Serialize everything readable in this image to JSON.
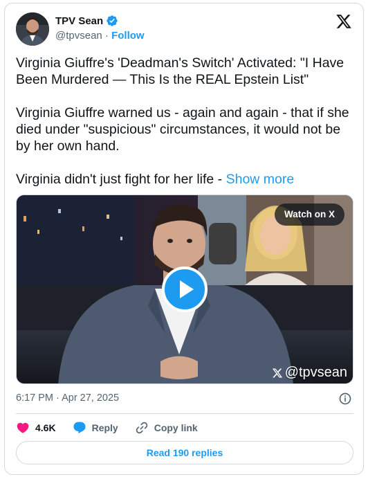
{
  "author": {
    "name": "TPV Sean",
    "handle": "@tpvsean",
    "separator": " · ",
    "follow_label": "Follow",
    "verified": true
  },
  "tweet": {
    "paragraphs": [
      "Virginia Giuffre's 'Deadman's Switch' Activated: \"I Have Been Murdered — This Is the REAL Epstein List\"",
      "Virginia Giuffre warned us - again and again - that if she died under \"suspicious\" circumstances, it would not be by her own hand.",
      "Virginia didn't just fight for her life - "
    ],
    "show_more_label": "Show more",
    "timestamp": "6:17 PM · Apr 27, 2025"
  },
  "media": {
    "watch_label": "Watch on X",
    "watermark_handle": "@tpvsean"
  },
  "actions": {
    "likes": "4.6K",
    "reply_label": "Reply",
    "copy_label": "Copy link",
    "read_replies_label": "Read 190 replies"
  },
  "colors": {
    "accent": "#1d9bf0",
    "like": "#f91880",
    "muted": "#536471",
    "border": "#cfd9de"
  }
}
